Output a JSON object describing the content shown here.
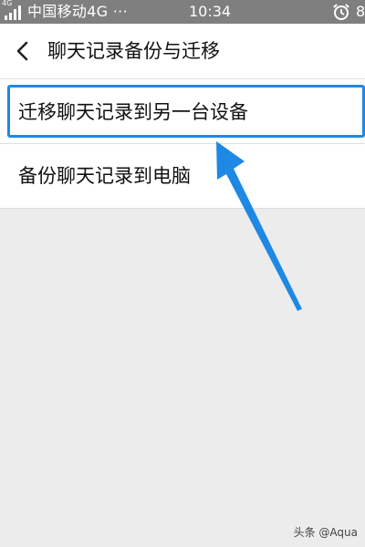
{
  "status_bar": {
    "network_type": "4G",
    "carrier": "中国移动4G ···",
    "time": "10:34",
    "battery": "8",
    "icons": [
      "signal-icon",
      "alarm-icon"
    ]
  },
  "nav": {
    "title": "聊天记录备份与迁移",
    "back_icon": "chevron-left-icon"
  },
  "menu": {
    "items": [
      {
        "label": "迁移聊天记录到另一台设备"
      },
      {
        "label": "备份聊天记录到电脑"
      }
    ]
  },
  "watermark": "头条 @Aqua",
  "colors": {
    "status_bar": "#7f7f7f",
    "highlight": "#1e88e5",
    "background": "#ececec"
  }
}
